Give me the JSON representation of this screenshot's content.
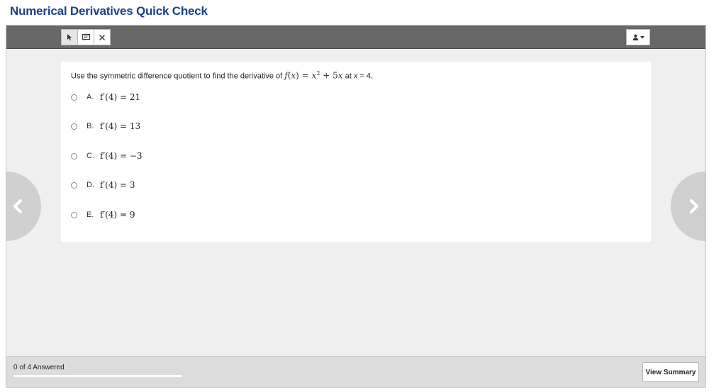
{
  "page": {
    "title": "Numerical Derivatives Quick Check"
  },
  "toolbar": {
    "tools": [
      {
        "name": "pointer-tool",
        "icon": "pointer-arrow-icon"
      },
      {
        "name": "note-tool",
        "icon": "note-icon"
      },
      {
        "name": "eliminate-tool",
        "icon": "eliminate-x-icon"
      }
    ],
    "user_menu_icon": "user-icon"
  },
  "question": {
    "prefix": "Use the symmetric difference quotient to find the derivative of ",
    "func_f": "f",
    "func_open": "(",
    "func_var": "x",
    "func_close": ")",
    "func_eq": " = ",
    "func_x": "x",
    "func_exp": "2",
    "func_plus": " + 5",
    "func_x2": "x",
    "at_text": " at ",
    "at_var": "x",
    "at_value": " = 4."
  },
  "choices": [
    {
      "letter": "A.",
      "expr": "f′(4) = 21"
    },
    {
      "letter": "B.",
      "expr": "f′(4) = 13"
    },
    {
      "letter": "C.",
      "expr": "f′(4) = −3"
    },
    {
      "letter": "D.",
      "expr": "f′(4) = 3"
    },
    {
      "letter": "E.",
      "expr": "f′(4) = 9"
    }
  ],
  "footer": {
    "answered_text": "0 of 4 Answered",
    "progress_fraction": 0,
    "view_summary_label": "View Summary"
  },
  "colors": {
    "title": "#1a3f8f",
    "toolbar": "#686868",
    "nav_arrow": "#cfcfcf"
  }
}
